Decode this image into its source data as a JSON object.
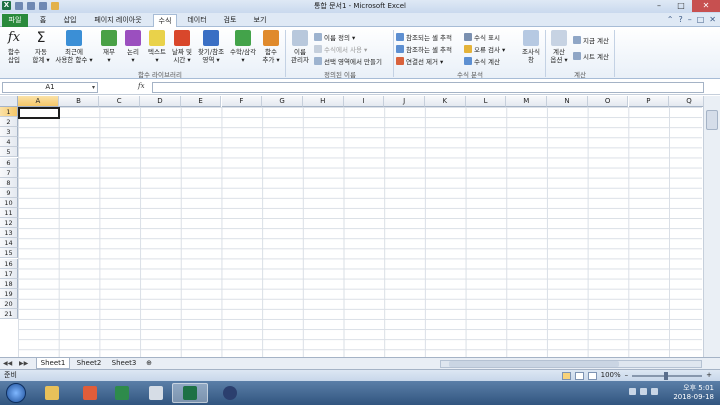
{
  "window": {
    "title": "통합 문서1 - Microsoft Excel"
  },
  "tabs": [
    "파일",
    "홈",
    "삽입",
    "페이지 레이아웃",
    "수식",
    "데이터",
    "검토",
    "보기"
  ],
  "ribbon": {
    "insert_function": [
      "함수",
      "삽입"
    ],
    "autosum": [
      "자동",
      "합계 ▾"
    ],
    "recent": [
      "최근에",
      "사용한 함수 ▾"
    ],
    "financial": [
      "재무",
      "▾"
    ],
    "logical": [
      "논리",
      "▾"
    ],
    "text": [
      "텍스트",
      "▾"
    ],
    "datetime": [
      "날짜 및",
      "시간 ▾"
    ],
    "lookup": [
      "찾기/참조",
      "영역 ▾"
    ],
    "math": [
      "수학/삼각",
      "▾"
    ],
    "more": [
      "함수",
      "추가 ▾"
    ],
    "group_function_library": "함수 라이브러리",
    "name_manager": [
      "이름",
      "관리자"
    ],
    "define_name": "이름 정의 ▾",
    "use_in_formula": "수식에서 사용 ▾",
    "create_from_selection": "선택 영역에서 만들기",
    "group_defined_names": "정의된 이름",
    "trace_precedents": "참조되는 셀 추적",
    "trace_dependents": "참조하는 셀 추적",
    "remove_arrows": "연결선 제거 ▾",
    "show_formulas": "수식 표시",
    "error_checking": "오류 검사 ▾",
    "evaluate_formula": "수식 계산",
    "group_formula_auditing": "수식 분석",
    "watch_window": [
      "조사식",
      "창"
    ],
    "calc_options": [
      "계산",
      "옵션 ▾"
    ],
    "calc_now": "지금 계산",
    "calc_sheet": "시트 계산",
    "group_calculation": "계산"
  },
  "formula_bar": {
    "name_box": "A1",
    "fx": "fx",
    "formula": ""
  },
  "grid": {
    "columns": [
      "A",
      "B",
      "C",
      "D",
      "E",
      "F",
      "G",
      "H",
      "I",
      "J",
      "K",
      "L",
      "M",
      "N",
      "O",
      "P",
      "Q"
    ],
    "rows": [
      "1",
      "2",
      "3",
      "4",
      "5",
      "6",
      "7",
      "8",
      "9",
      "10",
      "11",
      "12",
      "13",
      "14",
      "15",
      "16",
      "17",
      "18",
      "19",
      "20",
      "21"
    ],
    "active_cell": "A1"
  },
  "sheets": [
    "Sheet1",
    "Sheet2",
    "Sheet3"
  ],
  "status": {
    "mode": "준비",
    "zoom": "100%"
  },
  "taskbar": {
    "time": "오후 5:01",
    "date": "2018-09-18"
  }
}
